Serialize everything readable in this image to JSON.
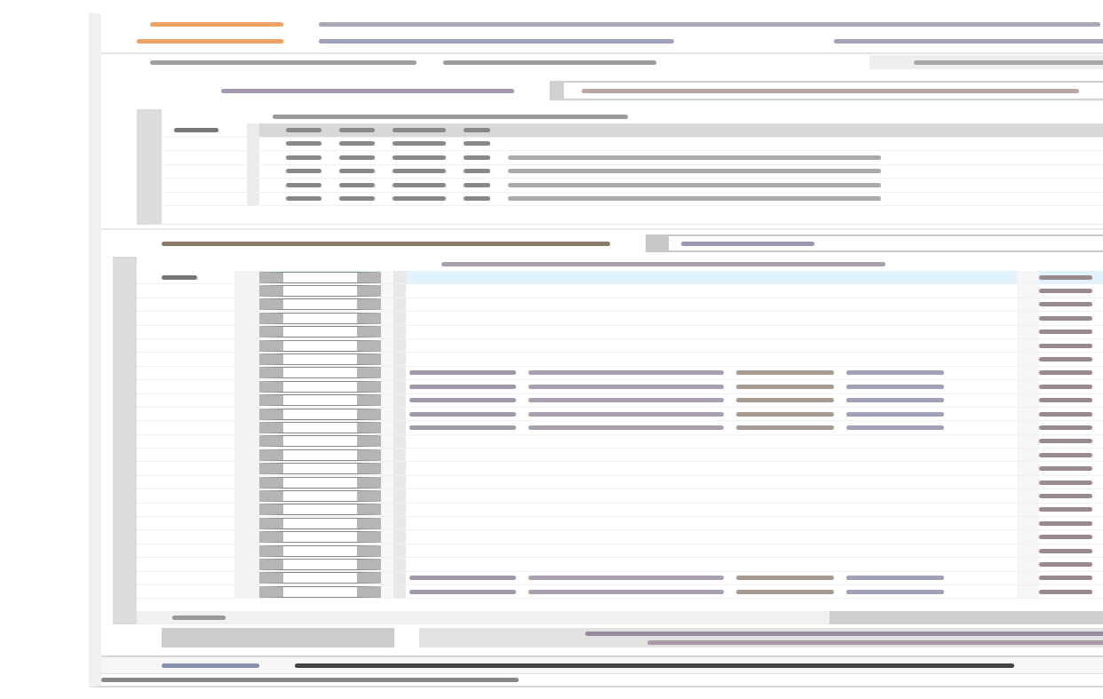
{
  "upper_table": {
    "rows": [
      {
        "selected": true,
        "detail": false
      },
      {
        "selected": false,
        "detail": false
      },
      {
        "selected": false,
        "detail": true
      },
      {
        "selected": false,
        "detail": true
      },
      {
        "selected": false,
        "detail": true
      },
      {
        "selected": false,
        "detail": true
      }
    ]
  },
  "lower_table": {
    "rows": [
      {
        "selected": true,
        "filled": false
      },
      {
        "selected": false,
        "filled": false
      },
      {
        "selected": false,
        "filled": false
      },
      {
        "selected": false,
        "filled": false
      },
      {
        "selected": false,
        "filled": false
      },
      {
        "selected": false,
        "filled": false
      },
      {
        "selected": false,
        "filled": false
      },
      {
        "selected": false,
        "filled": true
      },
      {
        "selected": false,
        "filled": true
      },
      {
        "selected": false,
        "filled": true
      },
      {
        "selected": false,
        "filled": true
      },
      {
        "selected": false,
        "filled": true
      },
      {
        "selected": false,
        "filled": false
      },
      {
        "selected": false,
        "filled": false
      },
      {
        "selected": false,
        "filled": false
      },
      {
        "selected": false,
        "filled": false
      },
      {
        "selected": false,
        "filled": false
      },
      {
        "selected": false,
        "filled": false
      },
      {
        "selected": false,
        "filled": false
      },
      {
        "selected": false,
        "filled": false
      },
      {
        "selected": false,
        "filled": false
      },
      {
        "selected": false,
        "filled": false
      },
      {
        "selected": false,
        "filled": true
      },
      {
        "selected": false,
        "filled": true
      }
    ]
  }
}
